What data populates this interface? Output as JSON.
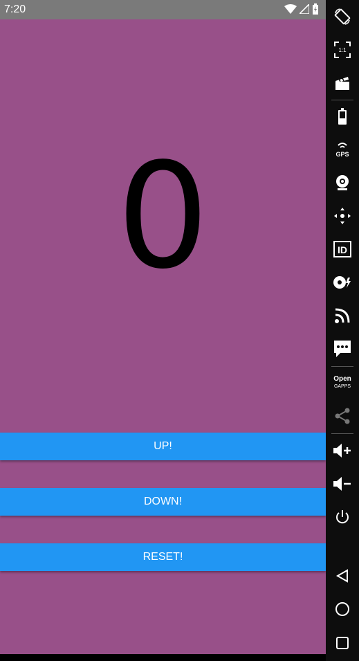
{
  "status_bar": {
    "time": "7:20"
  },
  "counter": {
    "value": "0"
  },
  "buttons": {
    "up": "UP!",
    "down": "DOWN!",
    "reset": "RESET!"
  },
  "emulator_toolbar": {
    "screen_ratio_label": "1:1",
    "gps_label": "GPS",
    "id_label": "ID",
    "opengapps_label_line1": "Open",
    "opengapps_label_line2": "GAPPS",
    "items": [
      "rotate-icon",
      "fit-screen-icon",
      "screen-record-icon",
      "battery-icon",
      "gps-icon",
      "webcam-icon",
      "move-icon",
      "device-id-icon",
      "disk-icon",
      "cast-icon",
      "sms-icon",
      "opengapps-icon",
      "share-icon",
      "volume-up-icon",
      "volume-down-icon",
      "power-icon",
      "back-icon",
      "home-icon",
      "recents-icon"
    ]
  },
  "colors": {
    "app_background": "#985089",
    "button": "#2196f3",
    "status_bar": "#7a7a7a"
  }
}
